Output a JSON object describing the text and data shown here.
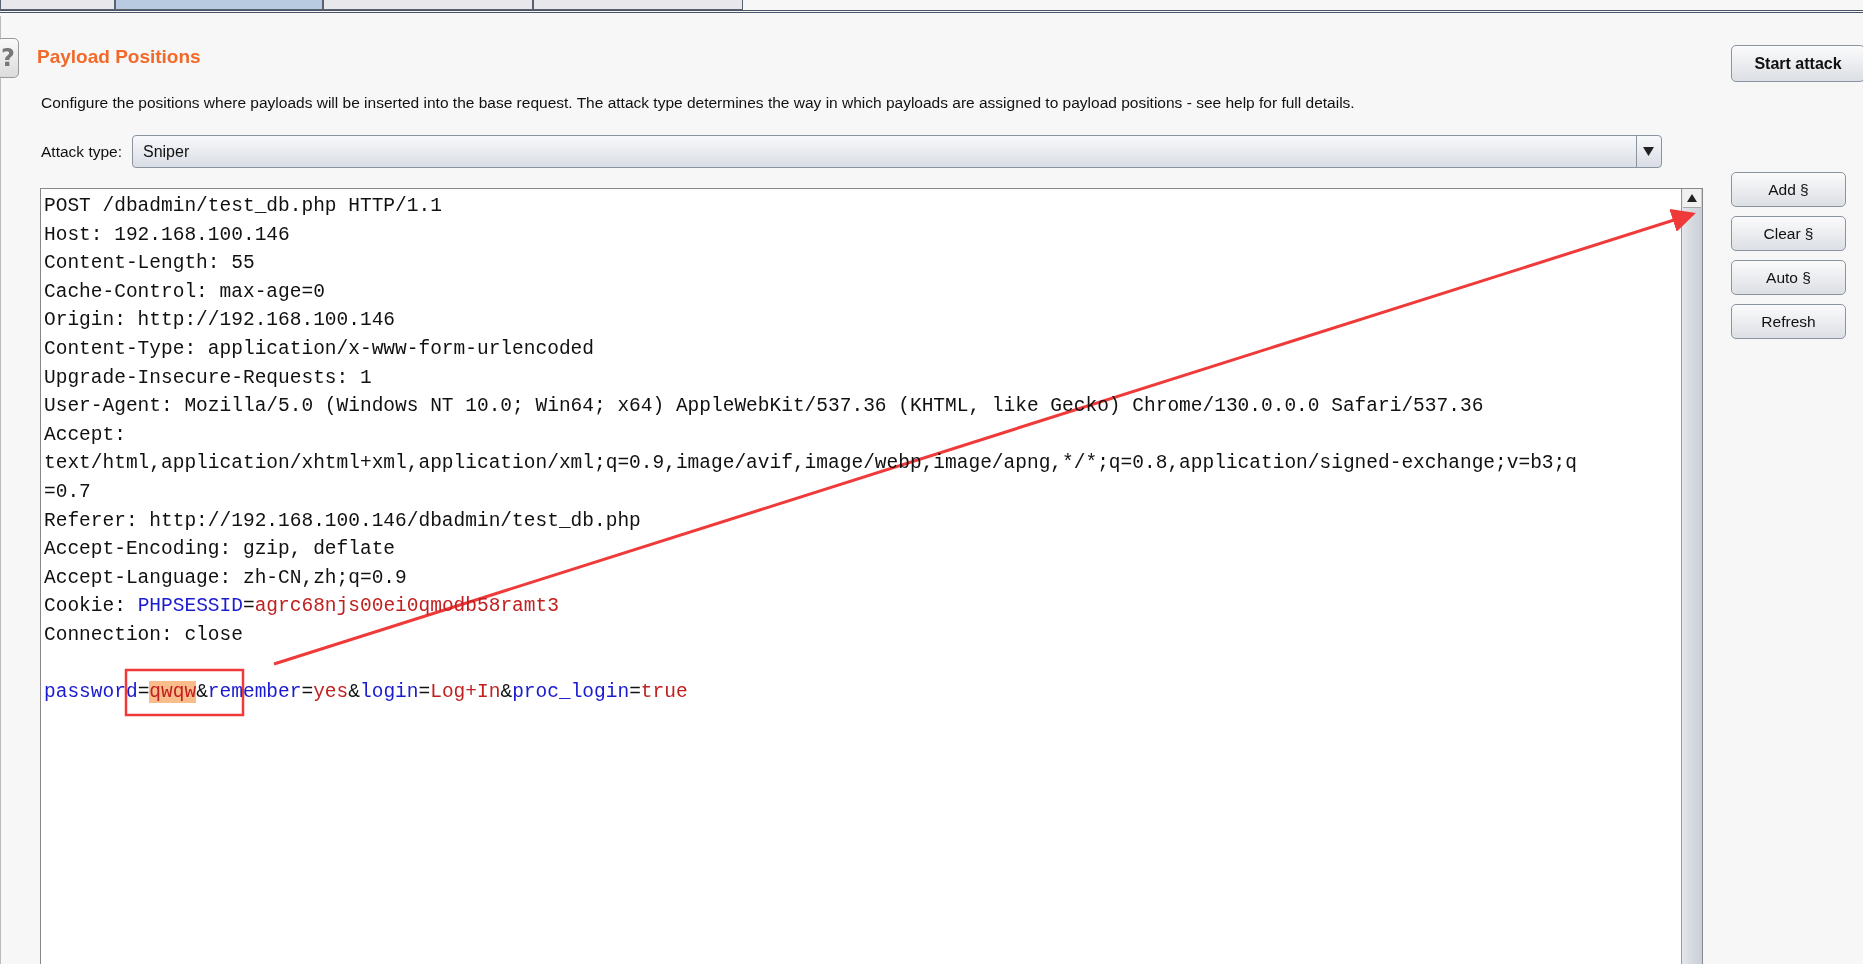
{
  "tabs": [
    {
      "selected": false
    },
    {
      "selected": true
    },
    {
      "selected": false
    },
    {
      "selected": false
    }
  ],
  "help_button": "?",
  "title": "Payload Positions",
  "description": "Configure the positions where payloads will be inserted into the base request. The attack type determines the way in which payloads are assigned to payload positions - see help for full details.",
  "start_button": "Start attack",
  "attack_type": {
    "label": "Attack type:",
    "value": "Sniper"
  },
  "request_lines": [
    [
      {
        "kind": "plain",
        "text": "POST /dbadmin/test_db.php HTTP/1.1"
      }
    ],
    [
      {
        "kind": "plain",
        "text": "Host: 192.168.100.146"
      }
    ],
    [
      {
        "kind": "plain",
        "text": "Content-Length: 55"
      }
    ],
    [
      {
        "kind": "plain",
        "text": "Cache-Control: max-age=0"
      }
    ],
    [
      {
        "kind": "plain",
        "text": "Origin: http://192.168.100.146"
      }
    ],
    [
      {
        "kind": "plain",
        "text": "Content-Type: application/x-www-form-urlencoded"
      }
    ],
    [
      {
        "kind": "plain",
        "text": "Upgrade-Insecure-Requests: 1"
      }
    ],
    [
      {
        "kind": "plain",
        "text": "User-Agent: Mozilla/5.0 (Windows NT 10.0; Win64; x64) AppleWebKit/537.36 (KHTML, like Gecko) Chrome/130.0.0.0 Safari/537.36"
      }
    ],
    [
      {
        "kind": "plain",
        "text": "Accept:"
      }
    ],
    [
      {
        "kind": "plain",
        "text": "text/html,application/xhtml+xml,application/xml;q=0.9,image/avif,image/webp,image/apng,*/*;q=0.8,application/signed-exchange;v=b3;q"
      }
    ],
    [
      {
        "kind": "plain",
        "text": "=0.7"
      }
    ],
    [
      {
        "kind": "plain",
        "text": "Referer: http://192.168.100.146/dbadmin/test_db.php"
      }
    ],
    [
      {
        "kind": "plain",
        "text": "Accept-Encoding: gzip, deflate"
      }
    ],
    [
      {
        "kind": "plain",
        "text": "Accept-Language: zh-CN,zh;q=0.9"
      }
    ],
    [
      {
        "kind": "plain",
        "text": "Cookie: "
      },
      {
        "kind": "name",
        "text": "PHPSESSID"
      },
      {
        "kind": "plain",
        "text": "="
      },
      {
        "kind": "value",
        "text": "agrc68njs00ei0qmodb58ramt3"
      }
    ],
    [
      {
        "kind": "plain",
        "text": "Connection: close"
      }
    ]
  ],
  "body_lines": [
    [
      {
        "kind": "name",
        "text": "password"
      },
      {
        "kind": "plain",
        "text": "="
      },
      {
        "kind": "selection",
        "text": "qwqw"
      },
      {
        "kind": "plain",
        "text": "&"
      },
      {
        "kind": "name",
        "text": "remember"
      },
      {
        "kind": "plain",
        "text": "="
      },
      {
        "kind": "value",
        "text": "yes"
      },
      {
        "kind": "plain",
        "text": "&"
      },
      {
        "kind": "name",
        "text": "login"
      },
      {
        "kind": "plain",
        "text": "="
      },
      {
        "kind": "value",
        "text": "Log+In"
      },
      {
        "kind": "plain",
        "text": "&"
      },
      {
        "kind": "name",
        "text": "proc_login"
      },
      {
        "kind": "plain",
        "text": "="
      },
      {
        "kind": "value",
        "text": "true"
      }
    ]
  ],
  "side_buttons": [
    "Add §",
    "Clear §",
    "Auto §",
    "Refresh"
  ]
}
